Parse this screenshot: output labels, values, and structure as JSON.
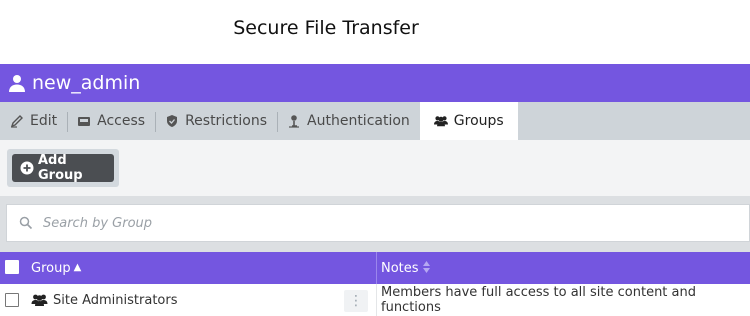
{
  "app": {
    "title": "Secure File Transfer"
  },
  "user": {
    "name": "new_admin"
  },
  "tabs": [
    {
      "label": "Edit",
      "icon": "edit-icon"
    },
    {
      "label": "Access",
      "icon": "inbox-icon"
    },
    {
      "label": "Restrictions",
      "icon": "shield-icon"
    },
    {
      "label": "Authentication",
      "icon": "person-key-icon"
    },
    {
      "label": "Groups",
      "icon": "users-icon",
      "active": true
    }
  ],
  "toolbar": {
    "add_label": "Add Group"
  },
  "search": {
    "placeholder": "Search by Group",
    "value": ""
  },
  "table": {
    "columns": [
      {
        "label": "Group",
        "sort": "ascending"
      },
      {
        "label": "Notes",
        "sort": "none"
      }
    ],
    "rows": [
      {
        "group": "Site Administrators",
        "notes": "Members have full access to all site content and functions"
      }
    ]
  },
  "colors": {
    "accent": "#7456e0",
    "tab_bar": "#ced4d9",
    "button": "#4b4e52"
  }
}
